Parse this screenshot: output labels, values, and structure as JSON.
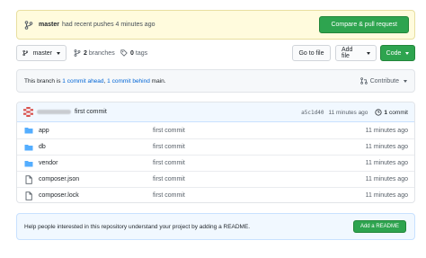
{
  "banner": {
    "branch": "master",
    "text": "had recent pushes 4 minutes ago",
    "compare_label": "Compare & pull request"
  },
  "toolbar": {
    "branch_select": "master",
    "branches_count": "2",
    "branches_label": "branches",
    "tags_count": "0",
    "tags_label": "tags",
    "go_to_file": "Go to file",
    "add_file": "Add file",
    "code": "Code"
  },
  "ahead": {
    "prefix": "This branch is",
    "ahead_link": "1 commit ahead",
    "sep": ",",
    "behind_link": "1 commit behind",
    "suffix": "main.",
    "contribute": "Contribute"
  },
  "commit": {
    "message": "first commit",
    "sha": "a5c1d40",
    "age": "11 minutes ago",
    "count": "1",
    "count_label": "commit"
  },
  "files": [
    {
      "name": "app",
      "type": "folder",
      "message": "first commit",
      "age": "11 minutes ago"
    },
    {
      "name": "db",
      "type": "folder",
      "message": "first commit",
      "age": "11 minutes ago"
    },
    {
      "name": "vendor",
      "type": "folder",
      "message": "first commit",
      "age": "11 minutes ago"
    },
    {
      "name": "composer.json",
      "type": "file",
      "message": "first commit",
      "age": "11 minutes ago"
    },
    {
      "name": "composer.lock",
      "type": "file",
      "message": "first commit",
      "age": "11 minutes ago"
    }
  ],
  "readme": {
    "text": "Help people interested in this repository understand your project by adding a README.",
    "button": "Add a README"
  },
  "colors": {
    "accent_green": "#2ea44f",
    "link_blue": "#0366d6",
    "folder_blue": "#54aeff"
  }
}
